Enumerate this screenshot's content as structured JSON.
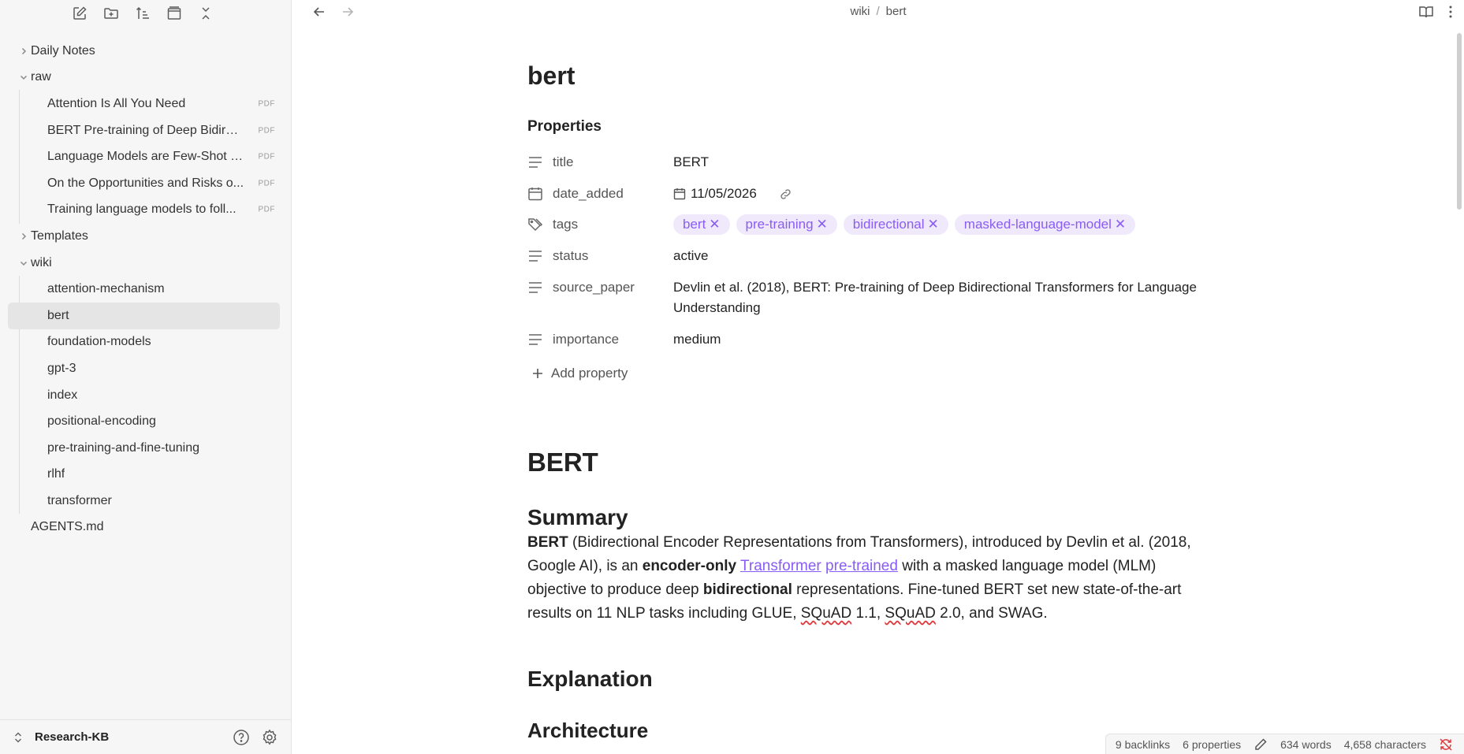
{
  "sidebar": {
    "toolbar": [
      "new-note",
      "new-folder",
      "sort",
      "layout",
      "collapse-all"
    ],
    "tree": [
      {
        "type": "folder",
        "label": "Daily Notes",
        "expanded": false
      },
      {
        "type": "folder",
        "label": "raw",
        "expanded": true
      },
      {
        "type": "file",
        "label": "Attention Is All You Need",
        "badge": "PDF"
      },
      {
        "type": "file",
        "label": "BERT Pre-training of Deep Bidirec...",
        "badge": "PDF"
      },
      {
        "type": "file",
        "label": "Language Models are Few-Shot L...",
        "badge": "PDF"
      },
      {
        "type": "file",
        "label": "On the Opportunities and Risks o...",
        "badge": "PDF"
      },
      {
        "type": "file",
        "label": "Training language models to foll...",
        "badge": "PDF"
      },
      {
        "type": "folder",
        "label": "Templates",
        "expanded": false
      },
      {
        "type": "folder",
        "label": "wiki",
        "expanded": true
      },
      {
        "type": "file",
        "label": "attention-mechanism"
      },
      {
        "type": "file",
        "label": "bert",
        "active": true
      },
      {
        "type": "file",
        "label": "foundation-models"
      },
      {
        "type": "file",
        "label": "gpt-3"
      },
      {
        "type": "file",
        "label": "index"
      },
      {
        "type": "file",
        "label": "positional-encoding"
      },
      {
        "type": "file",
        "label": "pre-training-and-fine-tuning"
      },
      {
        "type": "file",
        "label": "rlhf"
      },
      {
        "type": "file",
        "label": "transformer"
      },
      {
        "type": "root-file",
        "label": "AGENTS.md"
      }
    ],
    "vault_name": "Research-KB"
  },
  "breadcrumb": {
    "folder": "wiki",
    "sep": "/",
    "file": "bert"
  },
  "note": {
    "title": "bert",
    "properties_heading": "Properties",
    "properties": {
      "title": {
        "key": "title",
        "value": "BERT"
      },
      "date_added": {
        "key": "date_added",
        "value": "11/05/2026"
      },
      "tags": {
        "key": "tags",
        "values": [
          "bert",
          "pre-training",
          "bidirectional",
          "masked-language-model"
        ]
      },
      "status": {
        "key": "status",
        "value": "active"
      },
      "source_paper": {
        "key": "source_paper",
        "value": "Devlin et al. (2018), BERT: Pre-training of Deep Bidirectional Transformers for Language Understanding"
      },
      "importance": {
        "key": "importance",
        "value": "medium"
      }
    },
    "add_property": "Add property",
    "h1": "BERT",
    "summary_heading": "Summary",
    "summary": {
      "p1_bold": "BERT",
      "p1": " (Bidirectional Encoder Representations from Transformers), introduced by Devlin et al. (2018, Google AI), is an ",
      "p2_bold": "encoder-only",
      "link1": "Transformer",
      "link2": "pre-trained",
      "p3": " with a masked language model (MLM) objective to produce deep ",
      "p4_bold": "bidirectional",
      "p5": " representations. Fine-tuned BERT set new state-of-the-art results on 11 NLP tasks including GLUE, ",
      "squad1": "SQuAD",
      "p6": " 1.1, ",
      "squad2": "SQuAD",
      "p7": " 2.0, and SWAG."
    },
    "explanation_heading": "Explanation",
    "architecture_heading": "Architecture"
  },
  "status_bar": {
    "backlinks": "9 backlinks",
    "properties": "6 properties",
    "words": "634 words",
    "characters": "4,658 characters"
  }
}
